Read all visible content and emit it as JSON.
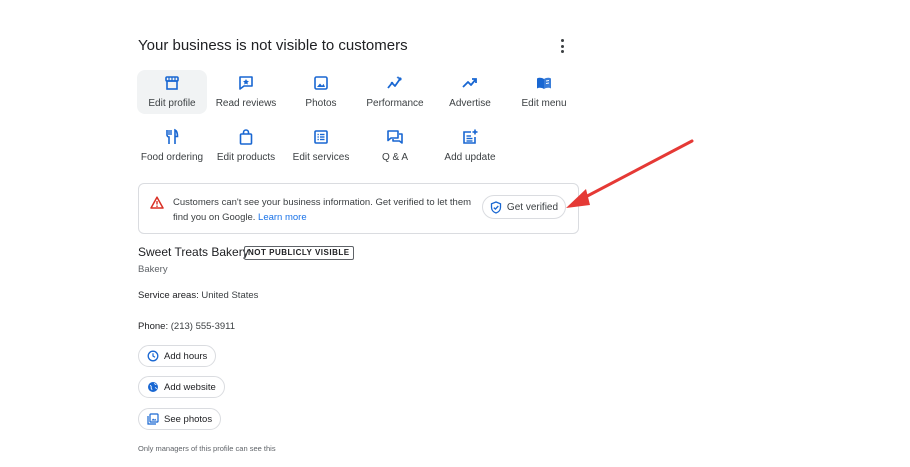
{
  "header": {
    "title": "Your business is not visible to customers"
  },
  "actions": [
    {
      "label": "Edit profile",
      "icon": "storefront-icon",
      "selected": true
    },
    {
      "label": "Read reviews",
      "icon": "review-star-icon"
    },
    {
      "label": "Photos",
      "icon": "image-icon"
    },
    {
      "label": "Performance",
      "icon": "insights-icon"
    },
    {
      "label": "Advertise",
      "icon": "trending-up-icon"
    },
    {
      "label": "Edit menu",
      "icon": "menu-book-icon"
    },
    {
      "label": "Food ordering",
      "icon": "restaurant-icon"
    },
    {
      "label": "Edit products",
      "icon": "shopping-bag-icon"
    },
    {
      "label": "Edit services",
      "icon": "list-alt-icon"
    },
    {
      "label": "Q & A",
      "icon": "forum-icon"
    },
    {
      "label": "Add update",
      "icon": "post-add-icon"
    }
  ],
  "banner": {
    "message": "Customers can't see your business information. Get verified to let them find you on Google.",
    "link": "Learn more",
    "button": "Get verified"
  },
  "business": {
    "name": "Sweet Treats Bakery",
    "badge": "NOT PUBLICLY VISIBLE",
    "category": "Bakery",
    "service_areas_label": "Service areas:",
    "service_areas_value": "United States",
    "phone_label": "Phone:",
    "phone_value": "(213) 555-3911"
  },
  "chips": {
    "hours": "Add hours",
    "website": "Add website",
    "photos": "See photos"
  },
  "footnote": "Only managers of this profile can see this",
  "colors": {
    "accent": "#1a73e8",
    "icon_blue": "#1967d2",
    "warning": "#d93025",
    "annotation_arrow": "#e53935"
  }
}
